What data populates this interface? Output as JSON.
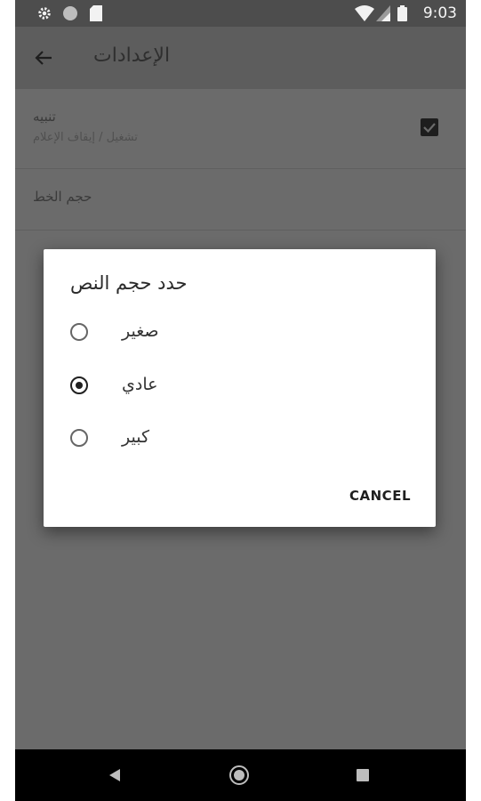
{
  "status_bar": {
    "time": "9:03",
    "left_icons": [
      "gear-icon",
      "circle-icon",
      "sd-card-icon"
    ],
    "right_icons": [
      "wifi-icon",
      "signal-icon",
      "battery-icon"
    ]
  },
  "app_bar": {
    "title": "الإعدادات",
    "back_icon": "arrow-left-icon"
  },
  "settings": {
    "notify": {
      "title": "تنبيه",
      "subtitle": "تشغيل / إيقاف الإعلام",
      "checked": true
    },
    "font_size": {
      "title": "حجم الخط"
    }
  },
  "dialog": {
    "title": "حدد حجم النص",
    "options": [
      {
        "label": "صغير",
        "selected": false
      },
      {
        "label": "عادي",
        "selected": true
      },
      {
        "label": "كبير",
        "selected": false
      }
    ],
    "cancel_label": "CANCEL"
  },
  "nav_bar": {
    "icons": [
      "back-triangle-icon",
      "home-circle-icon",
      "recents-square-icon"
    ]
  }
}
